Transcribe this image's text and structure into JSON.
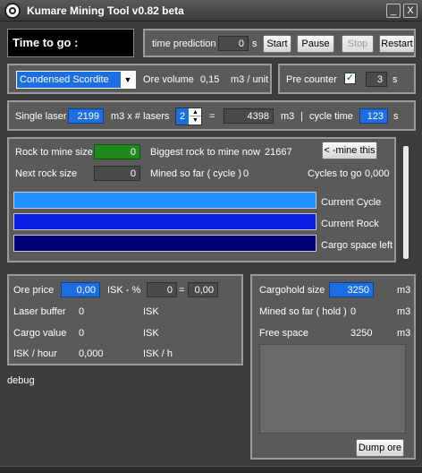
{
  "window": {
    "title": "Kumare Mining Tool v0.82 beta",
    "min_label": "_",
    "close_label": "X"
  },
  "timer": {
    "label": "Time to go :",
    "prediction_label": "time prediction",
    "prediction_value": "0",
    "prediction_unit": "s",
    "start_label": "Start",
    "pause_label": "Pause",
    "stop_label": "Stop",
    "restart_label": "Restart"
  },
  "ore": {
    "selected": "Condensed Scordite",
    "volume_label": "Ore volume",
    "volume_value": "0,15",
    "volume_unit": "m3 / unit",
    "precounter_label": "Pre counter",
    "precounter_value": "3",
    "precounter_unit": "s"
  },
  "laser": {
    "single_label": "Single laser",
    "single_value": "2199",
    "multiplier_label": "m3 x # lasers",
    "count_value": "2",
    "equals": "=",
    "total_value": "4398",
    "total_unit": "m3",
    "separator": "|",
    "cycle_label": "cycle time",
    "cycle_value": "123",
    "cycle_unit": "s"
  },
  "rock": {
    "size_label": "Rock to mine size",
    "size_value": "0",
    "biggest_label": "Biggest rock to mine now",
    "biggest_value": "21667",
    "mine_button": "< -mine this",
    "next_label": "Next rock size",
    "next_value": "0",
    "mined_cycle_label": "Mined so far ( cycle )",
    "mined_cycle_value": "0",
    "cycles_label": "Cycles to go",
    "cycles_value": "0,000"
  },
  "bars": [
    {
      "label": "Current Cycle",
      "fill": 1.0,
      "color": "#1e90ff"
    },
    {
      "label": "Current Rock",
      "fill": 1.0,
      "color": "#0a1ee6"
    },
    {
      "label": "Cargo space left",
      "fill": 1.0,
      "color": "#00007a"
    }
  ],
  "price": {
    "ore_price_label": "Ore price",
    "ore_price_value": "0,00",
    "isk_pct_label": "ISK - %",
    "isk_pct_value": "0",
    "equals": "=",
    "isk_result": "0,00",
    "laser_buffer_label": "Laser buffer",
    "laser_buffer_value": "0",
    "laser_buffer_unit": "ISK",
    "cargo_value_label": "Cargo value",
    "cargo_value_value": "0",
    "cargo_value_unit": "ISK",
    "isk_hour_label": "ISK / hour",
    "isk_hour_value": "0,000",
    "isk_hour_unit": "ISK / h"
  },
  "cargo": {
    "size_label": "Cargohold size",
    "size_value": "3250",
    "size_unit": "m3",
    "mined_label": "Mined so far ( hold )",
    "mined_value": "0",
    "mined_unit": "m3",
    "free_label": "Free space",
    "free_value": "3250",
    "free_unit": "m3",
    "dump_label": "Dump ore"
  },
  "debug_label": "debug"
}
